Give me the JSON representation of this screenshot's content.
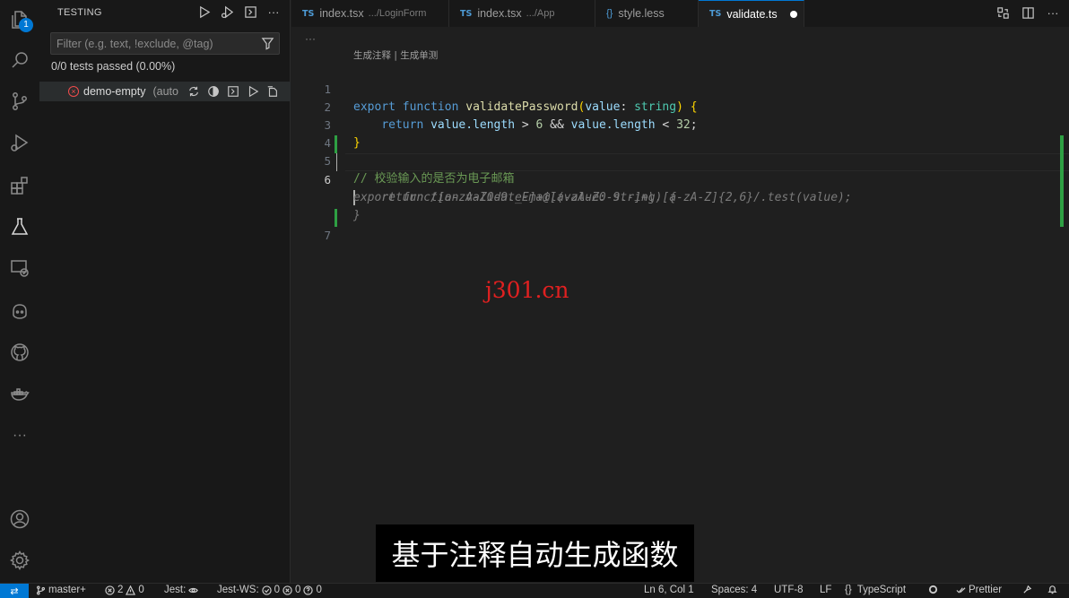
{
  "activity_bar": {
    "testing_badge": "1",
    "more_label": "···"
  },
  "sidebar": {
    "title": "TESTING",
    "more_label": "···",
    "filter_placeholder": "Filter (e.g. text, !exclude, @tag)",
    "summary": "0/0 tests passed (0.00%)",
    "tree_item": {
      "label": "demo-empty",
      "description": "(auto"
    }
  },
  "tabs": [
    {
      "icon": "TS",
      "name": "index.tsx",
      "path": ".../LoginForm",
      "active": false
    },
    {
      "icon": "TS",
      "name": "index.tsx",
      "path": ".../App",
      "active": false
    },
    {
      "icon": "{}",
      "name": "style.less",
      "path": "",
      "active": false
    },
    {
      "icon": "TS",
      "name": "validate.ts",
      "path": "",
      "active": true,
      "dirty": true
    }
  ],
  "editor": {
    "breadcrumb": "···",
    "codelens": "生成注释 | 生成单测",
    "line_numbers": [
      "1",
      "2",
      "3",
      "4",
      "5",
      "6",
      "7"
    ],
    "current_line": "6",
    "tokens": {
      "export": "export",
      "function": "function",
      "validatePassword": "validatePassword",
      "paren_open": "(",
      "value": "value",
      "colon": ": ",
      "string": "string",
      "paren_close": ")",
      "brace_open": "{",
      "return": "return",
      "value_length_1": "value.length",
      "gt": " > ",
      "six": "6",
      "and": " && ",
      "value_length_2": "value.length",
      "lt": " < ",
      "thirty_two": "32",
      "semicolon": ";",
      "brace_close": "}"
    },
    "comment": "// 校验输入的是否为电子邮箱",
    "suggestion_lines": [
      "export function validateEmail(value: string) {",
      "    return /[a-zA-Z0-9._-]+@[a-zA-Z0-9.-]+\\.[a-zA-Z]{2,6}/.test(value);",
      "}"
    ]
  },
  "overlay": {
    "watermark": "j301.cn",
    "subtitle": "基于注释自动生成函数"
  },
  "statusbar": {
    "remote_icon": "⇄",
    "branch": "master+",
    "errors": "2",
    "warnings": "0",
    "jest": "Jest:",
    "jest_ws": "Jest-WS:",
    "jest_ws_passed": "0",
    "jest_ws_failed": "0",
    "jest_ws_unknown": "0",
    "cursor": "Ln 6, Col 1",
    "spaces": "Spaces: 4",
    "encoding": "UTF-8",
    "eol": "LF",
    "language": "TypeScript",
    "formatter": "Prettier"
  },
  "colors": {
    "accent": "#0078d4",
    "git_added": "#2ea043",
    "error": "#f14c4c",
    "watermark": "#e02020"
  }
}
